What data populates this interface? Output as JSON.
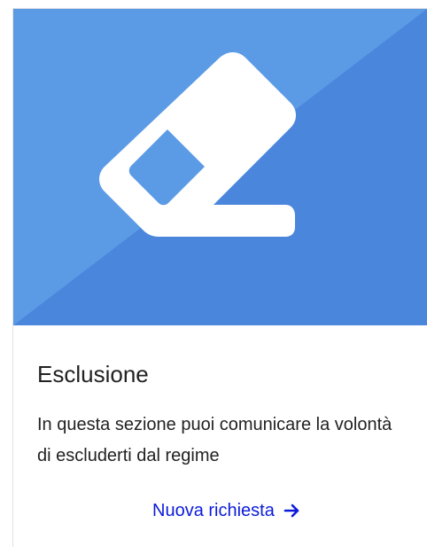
{
  "card": {
    "title": "Esclusione",
    "description": "In questa sezione puoi comunicare la volontà di escluderti dal regime",
    "action_label": "Nuova richiesta",
    "icon": "eraser-icon",
    "action_icon": "arrow-right-icon"
  },
  "colors": {
    "hero_light": "#5b9be6",
    "hero_dark": "#4a87dc",
    "icon": "#ffffff",
    "link": "#0b1bd9"
  }
}
